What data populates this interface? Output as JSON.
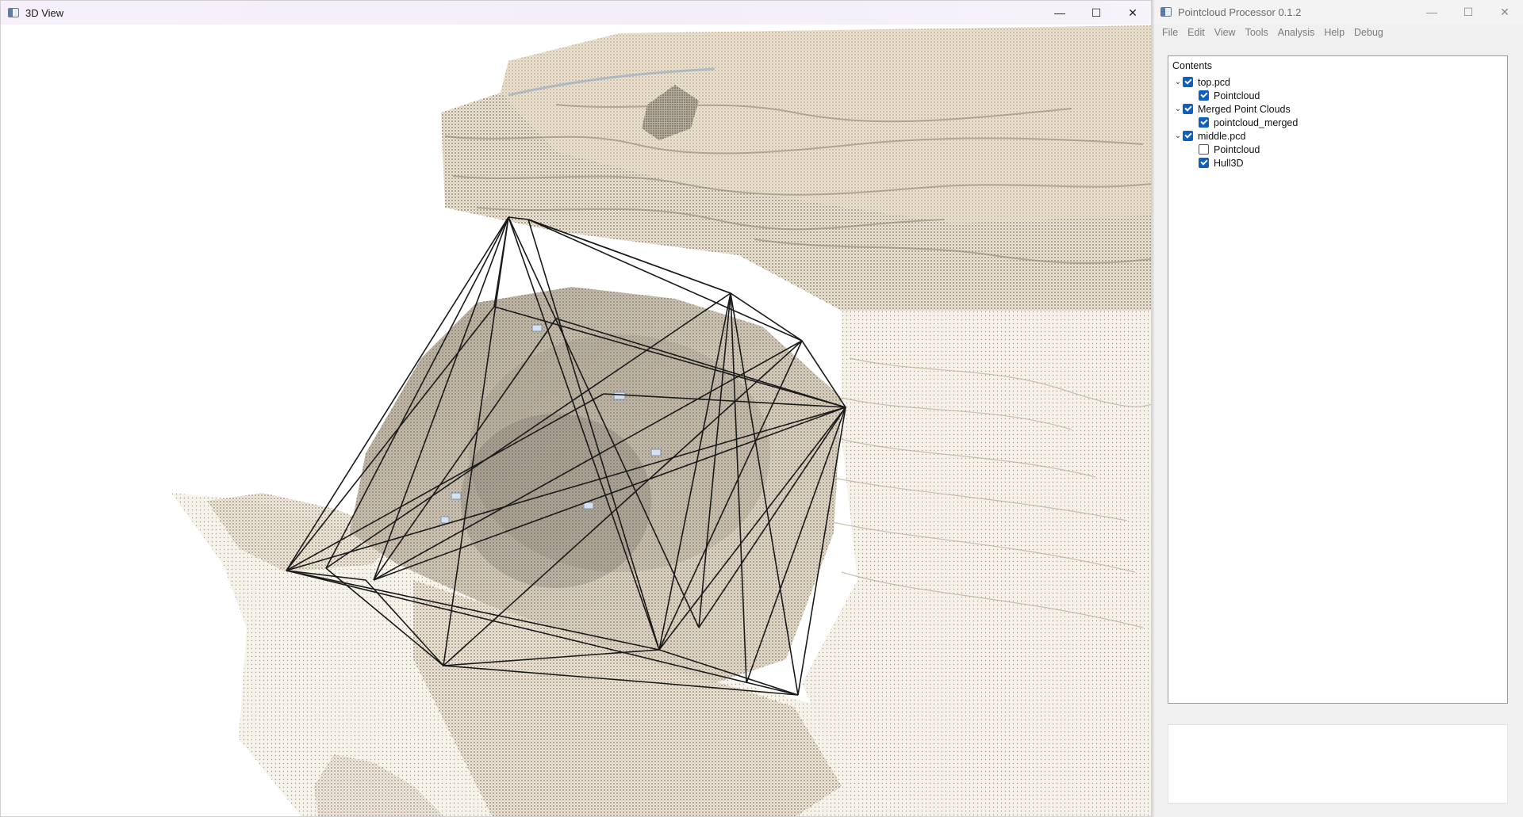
{
  "view3d": {
    "title": "3D View",
    "controls": {
      "minimize": "—",
      "maximize": "☐",
      "close": "✕"
    }
  },
  "processor": {
    "title": "Pointcloud Processor 0.1.2",
    "controls": {
      "minimize": "—",
      "maximize": "☐",
      "close": "✕"
    },
    "menu": [
      "File",
      "Edit",
      "View",
      "Tools",
      "Analysis",
      "Help",
      "Debug"
    ],
    "contents": {
      "header": "Contents",
      "items": [
        {
          "label": "top.pcd",
          "checked": true
        },
        {
          "label": "Pointcloud",
          "checked": true
        },
        {
          "label": "Merged Point Clouds",
          "checked": true
        },
        {
          "label": "pointcloud_merged",
          "checked": true
        },
        {
          "label": "middle.pcd",
          "checked": true
        },
        {
          "label": "Pointcloud",
          "checked": false
        },
        {
          "label": "Hull3D",
          "checked": true
        }
      ]
    },
    "colors": {
      "checkbox_accent": "#0f5fbf"
    }
  }
}
